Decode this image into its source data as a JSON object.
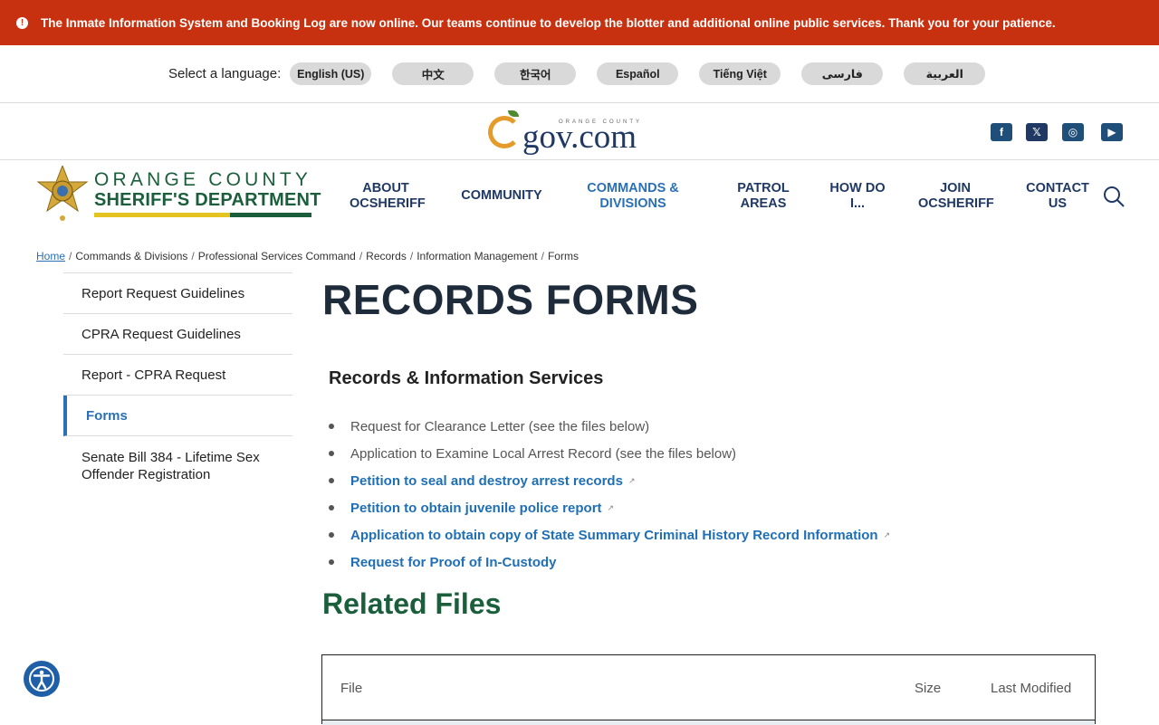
{
  "alert": {
    "text": "The Inmate Information System and Booking Log are now online. Our teams continue to develop the blotter and additional online public services. Thank you for your patience."
  },
  "language": {
    "label": "Select a language:",
    "options": [
      "English (US)",
      "中文",
      "한국어",
      "Español",
      "Tiếng Việt",
      "فارسی",
      "العربية"
    ]
  },
  "ocgov": {
    "logo_text": "gov.com",
    "small_text": "ORANGE COUNTY"
  },
  "social": [
    "facebook-icon",
    "x-icon",
    "instagram-icon",
    "youtube-icon"
  ],
  "dept": {
    "line1": "ORANGE COUNTY",
    "line2": "SHERIFF'S DEPARTMENT"
  },
  "nav": [
    {
      "l1": "ABOUT",
      "l2": "OCSHERIFF"
    },
    {
      "l1": "COMMUNITY",
      "l2": ""
    },
    {
      "l1": "COMMANDS &",
      "l2": "DIVISIONS"
    },
    {
      "l1": "PATROL",
      "l2": "AREAS"
    },
    {
      "l1": "HOW DO",
      "l2": "I..."
    },
    {
      "l1": "JOIN",
      "l2": "OCSHERIFF"
    },
    {
      "l1": "CONTACT",
      "l2": "US"
    }
  ],
  "breadcrumb": [
    "Home",
    "Commands & Divisions",
    "Professional Services Command",
    "Records",
    "Information Management",
    "Forms"
  ],
  "sidebar": [
    "Report Request Guidelines",
    "CPRA Request Guidelines",
    "Report - CPRA Request",
    "Forms",
    "Senate Bill 384 - Lifetime Sex Offender Registration"
  ],
  "page": {
    "title": "RECORDS FORMS",
    "subheading": "Records & Information Services",
    "items": [
      "Request for Clearance Letter  (see the files below)",
      "Application to Examine Local Arrest Record (see the files below)",
      "Petition to seal and destroy arrest records",
      "Petition to obtain juvenile police report",
      "Application to obtain copy of State Summary Criminal History Record Information",
      "Request for Proof of In-Custody"
    ],
    "related_title": "Related Files",
    "table_headers": {
      "file": "File",
      "size": "Size",
      "modified": "Last Modified"
    }
  }
}
